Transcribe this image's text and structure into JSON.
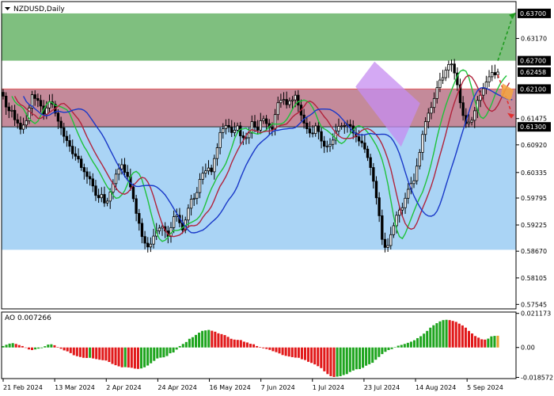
{
  "chart_data": [
    {
      "type": "candlestick",
      "title": "NZDUSD,Daily",
      "x_tick_labels": [
        "21 Feb 2024",
        "13 Mar 2024",
        "2 Apr 2024",
        "24 Apr 2024",
        "16 May 2024",
        "7 Jun 2024",
        "1 Jul 2024",
        "23 Jul 2024",
        "14 Aug 2024",
        "5 Sep 2024"
      ],
      "y_tick_labels": [
        "0.63700",
        "0.63170",
        "0.62700",
        "0.62458",
        "0.62100",
        "0.61475",
        "0.61300",
        "0.60920",
        "0.60335",
        "0.59795",
        "0.59225",
        "0.58670",
        "0.58105",
        "0.57545"
      ],
      "ylim": [
        0.5745,
        0.6395
      ],
      "current_price": 0.62458,
      "zones": [
        {
          "name": "upper",
          "from": 0.627,
          "to": 0.637,
          "color": "#7fbf7f"
        },
        {
          "name": "middle",
          "from": 0.613,
          "to": 0.621,
          "color": "#c48a9a"
        },
        {
          "name": "lower",
          "from": 0.587,
          "to": 0.613,
          "color": "#aad4f5"
        }
      ],
      "level_labels": [
        {
          "value": 0.637,
          "text": "0.63700"
        },
        {
          "value": 0.627,
          "text": "0.62700"
        },
        {
          "value": 0.62458,
          "text": "0.62458"
        },
        {
          "value": 0.621,
          "text": "0.62100"
        },
        {
          "value": 0.613,
          "text": "0.61300"
        }
      ],
      "levels": [
        {
          "y": 0.621,
          "color": "#e35a5a"
        },
        {
          "y": 0.613,
          "color": "#2a2a2a"
        }
      ],
      "closes": [
        0.6195,
        0.6172,
        0.6164,
        0.6165,
        0.6145,
        0.6138,
        0.6125,
        0.6134,
        0.6143,
        0.617,
        0.6198,
        0.619,
        0.6186,
        0.6174,
        0.6157,
        0.617,
        0.6183,
        0.6178,
        0.6159,
        0.6142,
        0.6128,
        0.611,
        0.6101,
        0.6089,
        0.6073,
        0.6068,
        0.6062,
        0.6044,
        0.6035,
        0.6025,
        0.602,
        0.6005,
        0.5985,
        0.598,
        0.5987,
        0.5969,
        0.5973,
        0.5992,
        0.601,
        0.603,
        0.6041,
        0.605,
        0.6034,
        0.6025,
        0.6003,
        0.5978,
        0.5947,
        0.5926,
        0.5898,
        0.5884,
        0.5876,
        0.5882,
        0.5899,
        0.591,
        0.5916,
        0.5919,
        0.591,
        0.5898,
        0.5917,
        0.594,
        0.5943,
        0.5927,
        0.5912,
        0.5933,
        0.5958,
        0.5977,
        0.5979,
        0.5991,
        0.6019,
        0.6032,
        0.6037,
        0.6043,
        0.6035,
        0.6063,
        0.6086,
        0.6118,
        0.6126,
        0.6133,
        0.6129,
        0.6118,
        0.6123,
        0.6132,
        0.6111,
        0.6107,
        0.6107,
        0.6117,
        0.6141,
        0.6129,
        0.6123,
        0.6143,
        0.6147,
        0.6137,
        0.6129,
        0.6125,
        0.6156,
        0.6181,
        0.6186,
        0.6188,
        0.6177,
        0.6185,
        0.6187,
        0.6197,
        0.6176,
        0.6155,
        0.6138,
        0.6126,
        0.6117,
        0.6116,
        0.6132,
        0.612,
        0.61,
        0.6089,
        0.6089,
        0.6093,
        0.6102,
        0.6121,
        0.6131,
        0.6132,
        0.6133,
        0.6135,
        0.6132,
        0.6117,
        0.6109,
        0.61,
        0.6096,
        0.6083,
        0.6065,
        0.6044,
        0.6015,
        0.598,
        0.5942,
        0.5892,
        0.5875,
        0.5879,
        0.5902,
        0.5921,
        0.5943,
        0.5954,
        0.5959,
        0.5979,
        0.5998,
        0.601,
        0.6016,
        0.6047,
        0.6076,
        0.6114,
        0.6141,
        0.6159,
        0.6171,
        0.619,
        0.6213,
        0.6229,
        0.6234,
        0.625,
        0.6262,
        0.6263,
        0.6244,
        0.6219,
        0.6181,
        0.6154,
        0.6137,
        0.614,
        0.6144,
        0.6164,
        0.6186,
        0.6197,
        0.6211,
        0.6225,
        0.6236,
        0.6245,
        0.624,
        0.6246
      ]
    },
    {
      "type": "histogram",
      "title": "AO 0.007266",
      "y_tick_labels": [
        "0.021173",
        "0.00",
        "-0.018572"
      ],
      "ylim": [
        -0.0193,
        0.022
      ],
      "colors": {
        "rising": "#1fa51f",
        "falling": "#e1191a",
        "last": "#e8a030"
      },
      "values": [
        0.0009,
        0.0017,
        0.0024,
        0.0027,
        0.0022,
        0.0015,
        0.0009,
        -0.0002,
        -0.0012,
        -0.0016,
        -0.0012,
        -0.0007,
        -0.0004,
        0.0008,
        0.0018,
        0.002,
        0.0014,
        0.0003,
        -0.0008,
        -0.0018,
        -0.0024,
        -0.0035,
        -0.0048,
        -0.0054,
        -0.0059,
        -0.0064,
        -0.0065,
        -0.0064,
        -0.0068,
        -0.0072,
        -0.0076,
        -0.0079,
        -0.0081,
        -0.009,
        -0.0102,
        -0.011,
        -0.0117,
        -0.0123,
        -0.0122,
        -0.0124,
        -0.0126,
        -0.0131,
        -0.0133,
        -0.013,
        -0.0123,
        -0.0112,
        -0.0098,
        -0.0083,
        -0.0068,
        -0.0063,
        -0.0061,
        -0.0053,
        -0.0036,
        -0.0031,
        -0.0013,
        0.0009,
        0.0022,
        0.0034,
        0.0054,
        0.0064,
        0.0078,
        0.0092,
        0.0103,
        0.0106,
        0.0109,
        0.0104,
        0.0098,
        0.0088,
        0.0083,
        0.0077,
        0.0066,
        0.0054,
        0.0049,
        0.0047,
        0.0046,
        0.0036,
        0.0031,
        0.0023,
        0.002,
        0.0009,
        0.0003,
        -0.0005,
        -0.0009,
        -0.0015,
        -0.0023,
        -0.0029,
        -0.0037,
        -0.0047,
        -0.0052,
        -0.0056,
        -0.006,
        -0.0063,
        -0.0064,
        -0.0073,
        -0.0078,
        -0.0089,
        -0.0096,
        -0.0105,
        -0.0116,
        -0.0128,
        -0.0148,
        -0.0165,
        -0.0178,
        -0.0183,
        -0.0181,
        -0.0178,
        -0.0171,
        -0.0165,
        -0.0152,
        -0.0143,
        -0.0135,
        -0.0134,
        -0.0126,
        -0.0113,
        -0.0104,
        -0.0095,
        -0.0076,
        -0.0059,
        -0.0041,
        -0.0027,
        -0.0016,
        -0.001,
        0.0002,
        0.0011,
        0.0016,
        0.0022,
        0.0029,
        0.0036,
        0.0045,
        0.0058,
        0.007,
        0.0086,
        0.0103,
        0.0123,
        0.0138,
        0.0151,
        0.0162,
        0.017,
        0.0172,
        0.017,
        0.0165,
        0.0159,
        0.0148,
        0.0137,
        0.0123,
        0.0103,
        0.0087,
        0.0071,
        0.0061,
        0.0051,
        0.0049,
        0.0055,
        0.0069,
        0.0072,
        0.0073
      ]
    }
  ]
}
